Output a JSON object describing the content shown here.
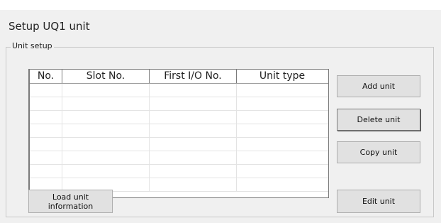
{
  "window": {
    "title": "Setup UQ1 unit"
  },
  "groupbox": {
    "legend": "Unit setup"
  },
  "table": {
    "columns": [
      "No.",
      "Slot No.",
      "First I/O No.",
      "Unit type"
    ],
    "rows": [
      [
        "",
        "",
        "",
        ""
      ],
      [
        "",
        "",
        "",
        ""
      ],
      [
        "",
        "",
        "",
        ""
      ],
      [
        "",
        "",
        "",
        ""
      ],
      [
        "",
        "",
        "",
        ""
      ],
      [
        "",
        "",
        "",
        ""
      ],
      [
        "",
        "",
        "",
        ""
      ],
      [
        "",
        "",
        "",
        ""
      ]
    ]
  },
  "buttons": {
    "add": "Add unit",
    "delete": "Delete unit",
    "copy": "Copy unit",
    "load": "Load unit information",
    "edit": "Edit unit"
  }
}
